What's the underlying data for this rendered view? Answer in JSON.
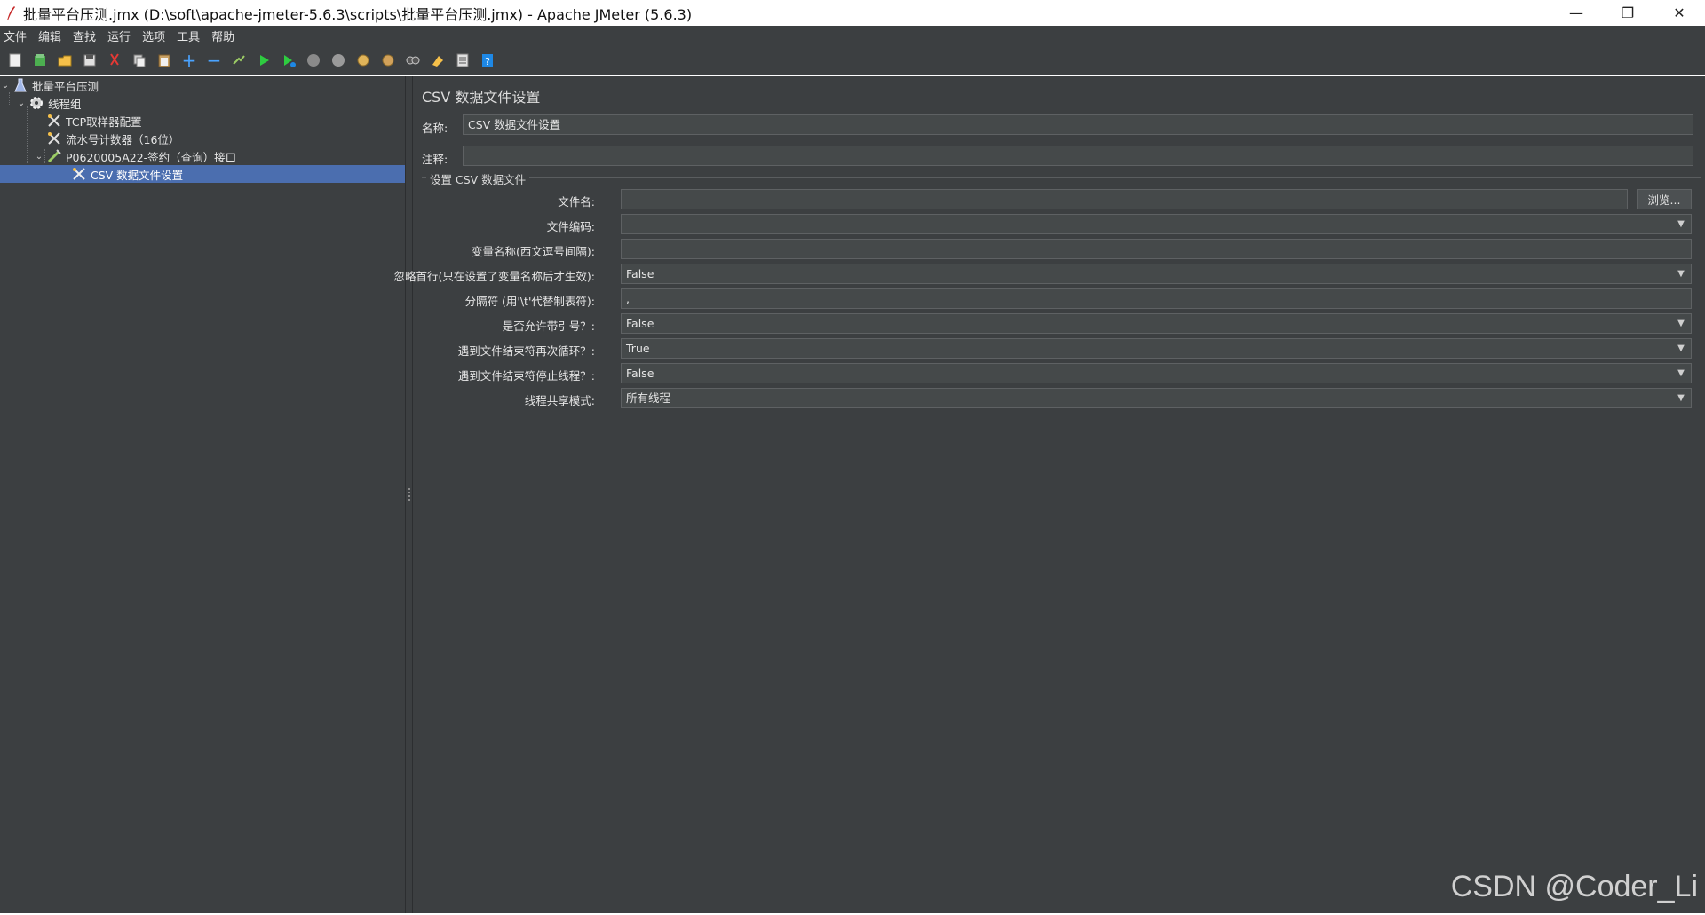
{
  "window": {
    "title": "批量平台压测.jmx (D:\\soft\\apache-jmeter-5.6.3\\scripts\\批量平台压测.jmx) - Apache JMeter (5.6.3)",
    "controls": {
      "minimize": "—",
      "restore": "❐",
      "close": "✕"
    }
  },
  "menu": [
    "文件",
    "编辑",
    "查找",
    "运行",
    "选项",
    "工具",
    "帮助"
  ],
  "toolbar": [
    {
      "name": "new-icon"
    },
    {
      "name": "templates-icon"
    },
    {
      "name": "open-icon"
    },
    {
      "name": "save-icon"
    },
    {
      "name": "cut-icon"
    },
    {
      "name": "copy-icon"
    },
    {
      "name": "paste-icon"
    },
    {
      "name": "expand-icon"
    },
    {
      "name": "collapse-icon"
    },
    {
      "name": "toggle-icon"
    },
    {
      "name": "start-icon"
    },
    {
      "name": "start-no-pause-icon"
    },
    {
      "name": "stop-icon"
    },
    {
      "name": "shutdown-icon"
    },
    {
      "name": "remote-start-icon"
    },
    {
      "name": "remote-stop-icon"
    },
    {
      "name": "search-icon"
    },
    {
      "name": "clear-icon"
    },
    {
      "name": "function-helper-icon"
    },
    {
      "name": "help-icon"
    }
  ],
  "tree": {
    "items": [
      {
        "label": "批量平台压测",
        "icon": "test-plan-icon"
      },
      {
        "label": "线程组",
        "icon": "thread-group-icon"
      },
      {
        "label": "TCP取样器配置",
        "icon": "config-element-icon"
      },
      {
        "label": "流水号计数器（16位）",
        "icon": "config-element-icon"
      },
      {
        "label": "P0620005A22-签约（查询）接口",
        "icon": "sampler-icon"
      },
      {
        "label": "CSV 数据文件设置",
        "icon": "config-element-icon"
      }
    ]
  },
  "panel": {
    "title": "CSV 数据文件设置",
    "name_label": "名称:",
    "name_value": "CSV 数据文件设置",
    "comment_label": "注释:",
    "comment_value": "",
    "group_title": "设置 CSV 数据文件",
    "browse_label": "浏览...",
    "fields": [
      {
        "label": "文件名:",
        "value": ""
      },
      {
        "label": "文件编码:",
        "value": ""
      },
      {
        "label": "变量名称(西文逗号间隔):",
        "value": ""
      },
      {
        "label": "忽略首行(只在设置了变量名称后才生效):",
        "value": "False"
      },
      {
        "label": "分隔符 (用'\\t'代替制表符):",
        "value": ","
      },
      {
        "label": "是否允许带引号？:",
        "value": "False"
      },
      {
        "label": "遇到文件结束符再次循环？:",
        "value": "True"
      },
      {
        "label": "遇到文件结束符停止线程？:",
        "value": "False"
      },
      {
        "label": "线程共享模式:",
        "value": "所有线程"
      }
    ]
  },
  "watermark": "CSDN @Coder_Li",
  "colors": {
    "background": "#3c3f41",
    "selection": "#4b6eaf",
    "field": "#45494a"
  }
}
